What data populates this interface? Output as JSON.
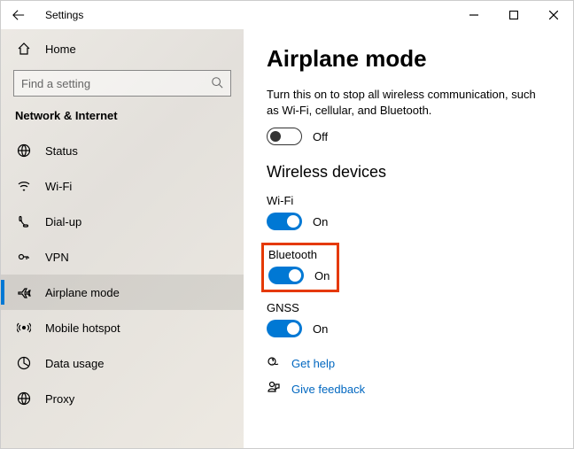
{
  "window": {
    "title": "Settings"
  },
  "sidebar": {
    "home": "Home",
    "searchPlaceholder": "Find a setting",
    "section": "Network & Internet",
    "items": [
      {
        "label": "Status"
      },
      {
        "label": "Wi-Fi"
      },
      {
        "label": "Dial-up"
      },
      {
        "label": "VPN"
      },
      {
        "label": "Airplane mode"
      },
      {
        "label": "Mobile hotspot"
      },
      {
        "label": "Data usage"
      },
      {
        "label": "Proxy"
      }
    ]
  },
  "main": {
    "heading": "Airplane mode",
    "description": "Turn this on to stop all wireless communication, such as Wi-Fi, cellular, and Bluetooth.",
    "airplaneState": "Off",
    "wirelessHeading": "Wireless devices",
    "devices": {
      "wifi": {
        "label": "Wi-Fi",
        "state": "On"
      },
      "bluetooth": {
        "label": "Bluetooth",
        "state": "On"
      },
      "gnss": {
        "label": "GNSS",
        "state": "On"
      }
    },
    "links": {
      "help": "Get help",
      "feedback": "Give feedback"
    }
  }
}
